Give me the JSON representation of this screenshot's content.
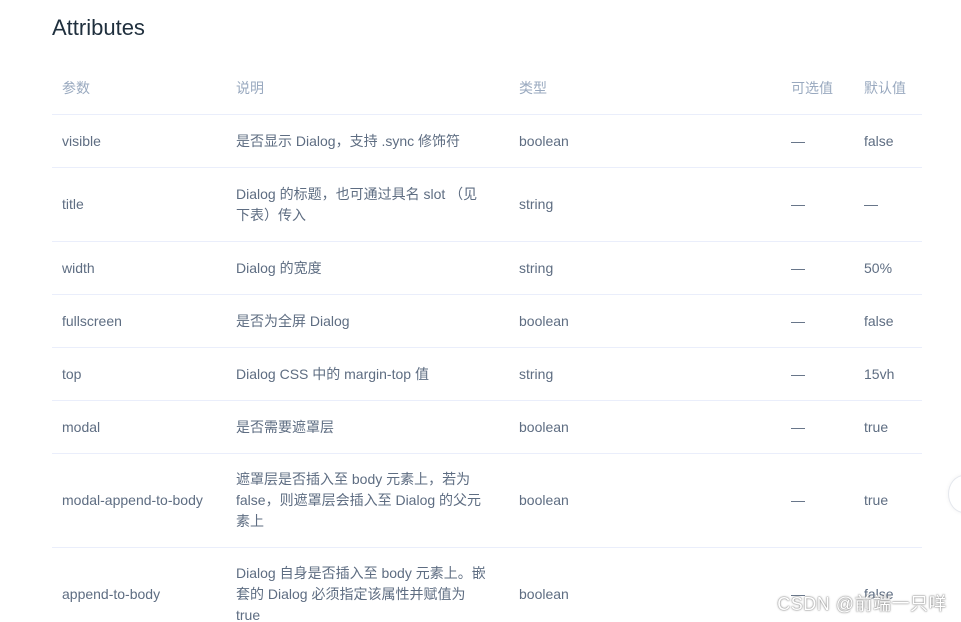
{
  "heading": "Attributes",
  "table": {
    "headers": [
      "参数",
      "说明",
      "类型",
      "可选值",
      "默认值"
    ],
    "rows": [
      {
        "param": "visible",
        "desc": "是否显示 Dialog，支持 .sync 修饰符",
        "type": "boolean",
        "options": "—",
        "default": "false"
      },
      {
        "param": "title",
        "desc": "Dialog 的标题，也可通过具名 slot （见下表）传入",
        "type": "string",
        "options": "—",
        "default": "—"
      },
      {
        "param": "width",
        "desc": "Dialog 的宽度",
        "type": "string",
        "options": "—",
        "default": "50%"
      },
      {
        "param": "fullscreen",
        "desc": "是否为全屏 Dialog",
        "type": "boolean",
        "options": "—",
        "default": "false"
      },
      {
        "param": "top",
        "desc": "Dialog CSS 中的 margin-top 值",
        "type": "string",
        "options": "—",
        "default": "15vh"
      },
      {
        "param": "modal",
        "desc": "是否需要遮罩层",
        "type": "boolean",
        "options": "—",
        "default": "true"
      },
      {
        "param": "modal-append-to-body",
        "desc": "遮罩层是否插入至 body 元素上，若为 false，则遮罩层会插入至 Dialog 的父元素上",
        "type": "boolean",
        "options": "—",
        "default": "true"
      },
      {
        "param": "append-to-body",
        "desc": "Dialog 自身是否插入至 body 元素上。嵌套的 Dialog 必须指定该属性并赋值为 true",
        "type": "boolean",
        "options": "—",
        "default": "false"
      }
    ]
  },
  "watermark": "CSDN @前端一只咩"
}
